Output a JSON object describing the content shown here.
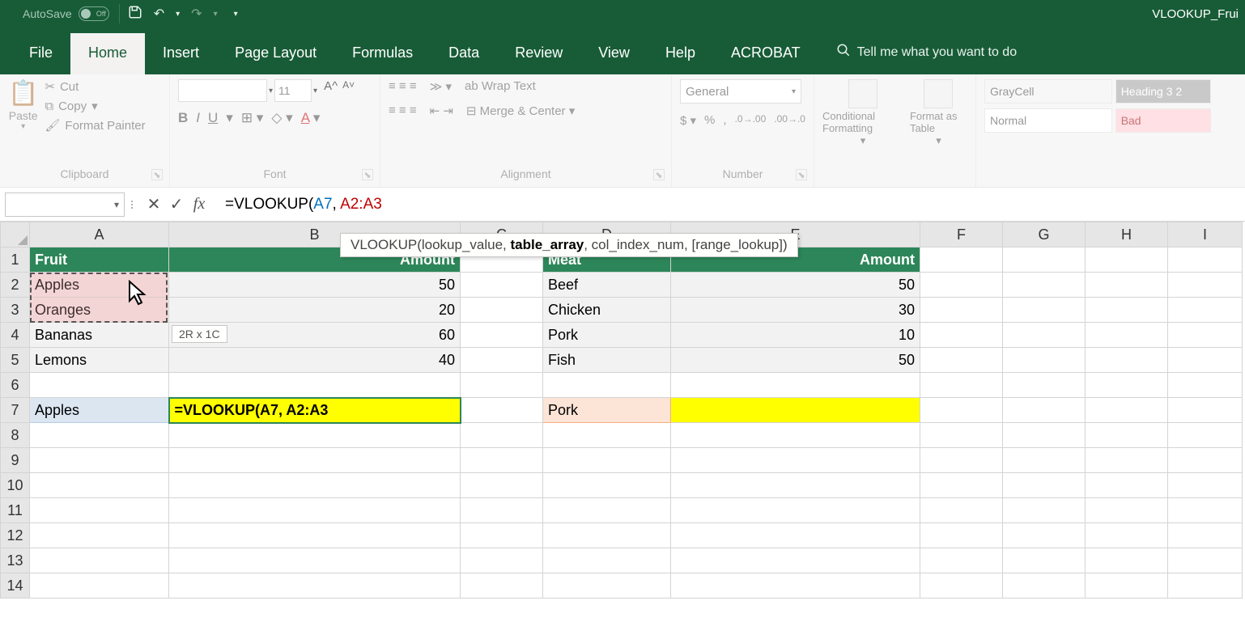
{
  "titlebar": {
    "autosave_label": "AutoSave",
    "autosave_state": "Off",
    "doc_title": "VLOOKUP_Frui"
  },
  "tabs": {
    "file": "File",
    "home": "Home",
    "insert": "Insert",
    "page_layout": "Page Layout",
    "formulas": "Formulas",
    "data": "Data",
    "review": "Review",
    "view": "View",
    "help": "Help",
    "acrobat": "ACROBAT",
    "tell_me": "Tell me what you want to do"
  },
  "ribbon": {
    "paste": "Paste",
    "cut": "Cut",
    "copy": "Copy",
    "format_painter": "Format Painter",
    "clipboard": "Clipboard",
    "font_size": "11",
    "font_group": "Font",
    "wrap_text": "Wrap Text",
    "merge_center": "Merge & Center",
    "alignment": "Alignment",
    "number_format": "General",
    "number_group": "Number",
    "cond_format": "Conditional Formatting",
    "format_table": "Format as Table",
    "style_gray": "GrayCell",
    "style_h3": "Heading 3 2",
    "style_normal": "Normal",
    "style_bad": "Bad"
  },
  "formulabar": {
    "formula_prefix": "=VLOOKUP(",
    "arg1": "A7",
    "sep": ", ",
    "arg2": "A2:A3",
    "tooltip_fn": "VLOOKUP(",
    "tooltip_a1": "lookup_value, ",
    "tooltip_a2": "table_array",
    "tooltip_rest": ", col_index_num, [range_lookup])"
  },
  "columns": [
    "A",
    "B",
    "C",
    "D",
    "E",
    "F",
    "G",
    "H",
    "I"
  ],
  "row_count": 14,
  "sheet": {
    "A1": "Fruit",
    "B1": "Amount",
    "A2": "Apples",
    "B2": "50",
    "A3": "Oranges",
    "B3": "20",
    "A4": "Bananas",
    "B4": "60",
    "A5": "Lemons",
    "B5": "40",
    "A7": "Apples",
    "B7": "=VLOOKUP(A7, A2:A3",
    "D1": "Meat",
    "E1": "Amount",
    "D2": "Beef",
    "E2": "50",
    "D3": "Chicken",
    "E3": "30",
    "D4": "Pork",
    "E4": "10",
    "D5": "Fish",
    "E5": "50",
    "D7": "Pork"
  },
  "size_tooltip": "2R x 1C"
}
